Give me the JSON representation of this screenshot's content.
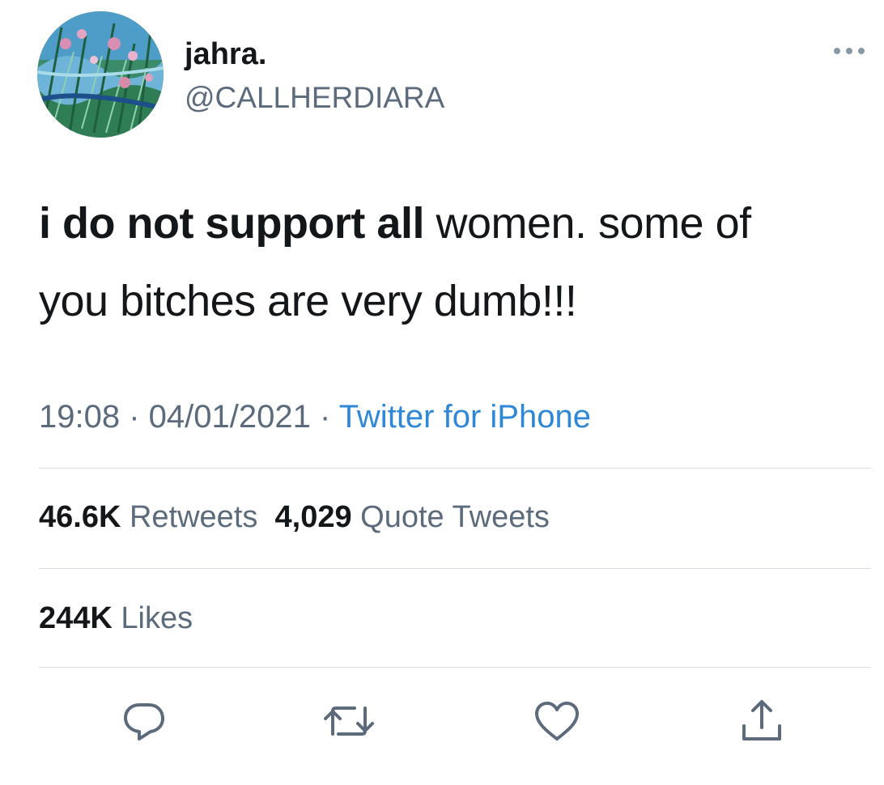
{
  "user": {
    "display_name": "jahra.",
    "handle": "@CALLHERDIARA",
    "avatar_icon": "avatar-painting"
  },
  "tweet": {
    "text_bold": "i do not support all",
    "text_regular_line1": " women. some of",
    "text_regular_line2": "you bitches are very dumb!!!"
  },
  "meta": {
    "time": "19:08",
    "separator": " · ",
    "date": "04/01/2021",
    "source": "Twitter for iPhone"
  },
  "stats": {
    "retweets_count": "46.6K",
    "retweets_label": "Retweets",
    "quotes_count": "4,029",
    "quotes_label": "Quote Tweets",
    "likes_count": "244K",
    "likes_label": "Likes"
  },
  "colors": {
    "text": "#14171a",
    "secondary": "#5b6b7b",
    "link": "#2f87d8",
    "divider": "#d6dce2"
  },
  "actions": [
    "reply-icon",
    "retweet-icon",
    "like-icon",
    "share-icon"
  ]
}
